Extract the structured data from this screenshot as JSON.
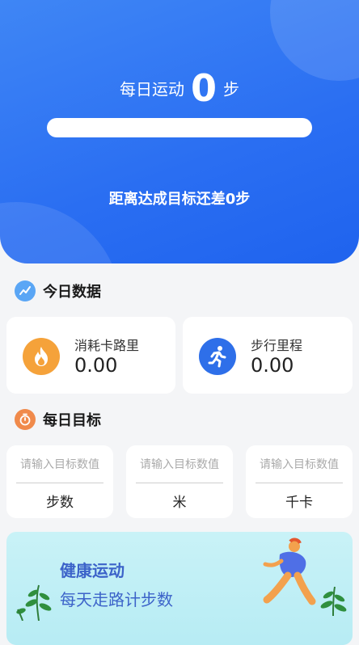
{
  "hero": {
    "daily_label": "每日运动",
    "steps": "0",
    "steps_unit": "步",
    "progress": 0,
    "remaining_text": "距离达成目标还差0步"
  },
  "today": {
    "title": "今日数据",
    "calories": {
      "label": "消耗卡路里",
      "value": "0.00",
      "icon": "flame-icon"
    },
    "distance": {
      "label": "步行里程",
      "value": "0.00",
      "icon": "running-person-icon"
    }
  },
  "goals": {
    "title": "每日目标",
    "items": [
      {
        "placeholder": "请输入目标数值",
        "unit": "步数"
      },
      {
        "placeholder": "请输入目标数值",
        "unit": "米"
      },
      {
        "placeholder": "请输入目标数值",
        "unit": "千卡"
      }
    ]
  },
  "banner": {
    "title": "健康运动",
    "subtitle": "每天走路计步数"
  },
  "colors": {
    "primary": "#2a6ef2",
    "flame": "#f5a23a",
    "runner": "#2e6fe9",
    "banner_text": "#3c63c9"
  }
}
